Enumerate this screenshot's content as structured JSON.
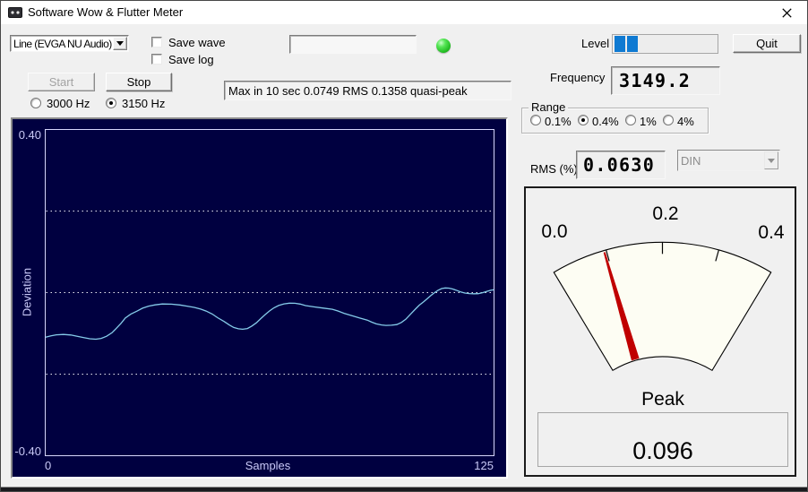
{
  "window": {
    "title": "Software Wow & Flutter Meter"
  },
  "colors": {
    "background": "#f0f0f0",
    "titlebar": "#ffffff",
    "plot_background": "#000040",
    "plot_axis": "#d6d6fa",
    "plot_grid": "#e9e9f2",
    "plot_text": "#c9c9f6",
    "curve": "#85cbe9",
    "level_block": "#0f7ad2",
    "led_green": "#2fc52f",
    "needle_red": "#c00000",
    "gauge_face": "#fdfdf3"
  },
  "controls": {
    "device_combo": {
      "value": "Line (EVGA NU Audio)"
    },
    "save_wave": {
      "label": "Save wave",
      "checked": false
    },
    "save_log": {
      "label": "Save log",
      "checked": false
    },
    "filename_field": {
      "value": "",
      "placeholder": ""
    },
    "led": {
      "state": "green"
    },
    "level": {
      "label": "Level",
      "filled_blocks": 2
    },
    "quit_button": {
      "label": "Quit"
    },
    "start_button": {
      "label": "Start",
      "disabled": true
    },
    "stop_button": {
      "label": "Stop",
      "disabled": false
    },
    "freq_3000": {
      "label": "3000 Hz",
      "selected": false
    },
    "freq_3150": {
      "label": "3150 Hz",
      "selected": true
    },
    "status_text": "Max in 10 sec 0.0749 RMS 0.1358 quasi-peak",
    "frequency": {
      "label": "Frequency",
      "value": "3149.2"
    },
    "range_group": {
      "label": "Range",
      "options": [
        {
          "label": "0.1%",
          "selected": false
        },
        {
          "label": "0.4%",
          "selected": true
        },
        {
          "label": "1%",
          "selected": false
        },
        {
          "label": "4%",
          "selected": false
        }
      ]
    },
    "rms": {
      "label": "RMS (%)",
      "value": "0.0630"
    },
    "weighting_combo": {
      "value": "DIN",
      "disabled": true
    }
  },
  "meter": {
    "type": "gauge",
    "min": 0,
    "max": 0.4,
    "scale_labels": [
      "0.0",
      "0.2",
      "0.4"
    ],
    "tick_values": [
      0.1,
      0.2,
      0.3
    ],
    "needle_value": 0.096,
    "peak_label": "Peak",
    "peak_value": "0.096"
  },
  "chart_data": {
    "type": "line",
    "title": "",
    "xlabel": "Samples",
    "ylabel": "Deviation",
    "xlim": [
      0,
      125
    ],
    "ylim": [
      -0.4,
      0.4
    ],
    "x_tick_labels": [
      "0",
      "125"
    ],
    "y_tick_labels": [
      "0.40",
      "-0.40"
    ],
    "gridlines_y": [
      0.2,
      0,
      -0.2
    ],
    "grid_style": "dotted",
    "series": [
      {
        "name": "deviation",
        "points": [
          [
            0.1,
            -0.1092
          ],
          [
            1.6,
            -0.1062
          ],
          [
            3.1,
            -0.1035
          ],
          [
            5.1,
            -0.1026
          ],
          [
            7.1,
            -0.104
          ],
          [
            8.9,
            -0.1073
          ],
          [
            10.6,
            -0.1101
          ],
          [
            12.4,
            -0.1132
          ],
          [
            14.1,
            -0.1143
          ],
          [
            15.6,
            -0.1123
          ],
          [
            17.1,
            -0.107
          ],
          [
            18.6,
            -0.0985
          ],
          [
            19.8,
            -0.0875
          ],
          [
            21.1,
            -0.0754
          ],
          [
            22.3,
            -0.0622
          ],
          [
            23.8,
            -0.053
          ],
          [
            25.6,
            -0.0453
          ],
          [
            27.1,
            -0.0382
          ],
          [
            28.8,
            -0.0332
          ],
          [
            30.6,
            -0.0301
          ],
          [
            32.6,
            -0.0279
          ],
          [
            35.1,
            -0.0284
          ],
          [
            37.5,
            -0.0303
          ],
          [
            39.5,
            -0.0332
          ],
          [
            41.5,
            -0.0363
          ],
          [
            43.3,
            -0.0404
          ],
          [
            44.8,
            -0.0453
          ],
          [
            46.5,
            -0.0525
          ],
          [
            48.0,
            -0.0615
          ],
          [
            49.8,
            -0.0708
          ],
          [
            51.3,
            -0.0796
          ],
          [
            52.5,
            -0.0855
          ],
          [
            53.8,
            -0.0888
          ],
          [
            55.0,
            -0.0899
          ],
          [
            56.3,
            -0.0881
          ],
          [
            57.5,
            -0.0822
          ],
          [
            58.8,
            -0.0741
          ],
          [
            60.0,
            -0.064
          ],
          [
            61.3,
            -0.0536
          ],
          [
            62.5,
            -0.0448
          ],
          [
            63.7,
            -0.0374
          ],
          [
            65.0,
            -0.0316
          ],
          [
            66.5,
            -0.0277
          ],
          [
            68.0,
            -0.0259
          ],
          [
            69.5,
            -0.0262
          ],
          [
            71.0,
            -0.0281
          ],
          [
            72.5,
            -0.0319
          ],
          [
            75.0,
            -0.0352
          ],
          [
            77.5,
            -0.038
          ],
          [
            80.0,
            -0.0409
          ],
          [
            81.5,
            -0.0451
          ],
          [
            83.2,
            -0.0508
          ],
          [
            85.2,
            -0.056
          ],
          [
            87.5,
            -0.0622
          ],
          [
            89.7,
            -0.0675
          ],
          [
            90.9,
            -0.0723
          ],
          [
            92.2,
            -0.0767
          ],
          [
            93.7,
            -0.0793
          ],
          [
            94.9,
            -0.0804
          ],
          [
            96.4,
            -0.08
          ],
          [
            97.9,
            -0.0785
          ],
          [
            99.2,
            -0.0732
          ],
          [
            100.4,
            -0.0655
          ],
          [
            101.9,
            -0.0514
          ],
          [
            103.2,
            -0.0396
          ],
          [
            104.2,
            -0.0308
          ],
          [
            105.4,
            -0.0226
          ],
          [
            106.4,
            -0.0147
          ],
          [
            107.4,
            -0.0073
          ],
          [
            108.4,
            -0.0002
          ],
          [
            109.4,
            0.0057
          ],
          [
            110.4,
            0.0099
          ],
          [
            111.4,
            0.0114
          ],
          [
            112.4,
            0.011
          ],
          [
            113.4,
            0.009
          ],
          [
            114.4,
            0.0062
          ],
          [
            115.6,
            0.002
          ],
          [
            116.9,
            -0.0011
          ],
          [
            118.1,
            -0.0024
          ],
          [
            119.4,
            -0.0029
          ],
          [
            120.6,
            -0.0026
          ],
          [
            121.9,
            0.0
          ],
          [
            123.1,
            0.0033
          ],
          [
            124.1,
            0.0057
          ],
          [
            124.9,
            0.0068
          ]
        ]
      }
    ]
  }
}
